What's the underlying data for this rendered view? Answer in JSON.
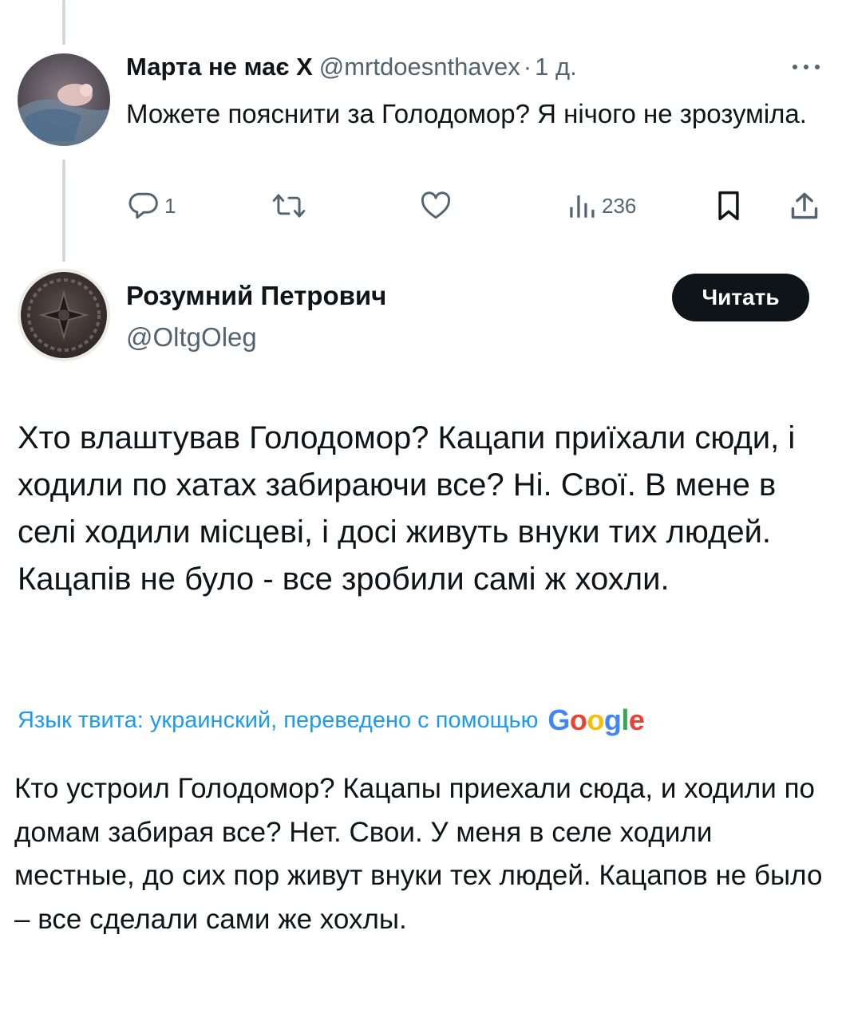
{
  "reply": {
    "author_name": "Марта не має Х",
    "handle": "@mrtdoesnthavex",
    "separator": "·",
    "time": "1 д.",
    "text": "Можете пояснити за Голодомор? Я нічого не зрозуміла.",
    "actions": {
      "reply_icon": "reply-icon",
      "reply_count": "1",
      "retweet_icon": "retweet-icon",
      "like_icon": "heart-icon",
      "views_icon": "views-icon",
      "views_count": "236",
      "bookmark_icon": "bookmark-icon",
      "share_icon": "share-icon"
    }
  },
  "main_tweet": {
    "author_name": "Розумний Петрович",
    "handle": "@OltgOleg",
    "follow_label": "Читать",
    "text": "Хто влаштував Голодомор? Кацапи приїхали сюди, і ходили по хатах забираючи все? Ні. Свої. В мене в селі ходили місцеві, і досі живуть внуки тих людей. Кацапів не було - все зробили самі ж хохли.",
    "translation_notice": "Язык твита: украинский, переведено с помощью",
    "translation_provider": [
      "G",
      "o",
      "o",
      "g",
      "l",
      "e"
    ],
    "translated_text": "Кто устроил Голодомор? Кацапы приехали сюда, и ходили по домам забирая все? Нет. Свои. У меня в селе ходили местные, до сих пор живут внуки тех людей. Кацапов не было – все сделали сами же хохлы."
  },
  "colors": {
    "text_primary": "#0f1419",
    "text_secondary": "#536471",
    "link_blue": "#1d9bf0",
    "button_bg": "#0f1419",
    "thread_line": "#cfd9de"
  }
}
